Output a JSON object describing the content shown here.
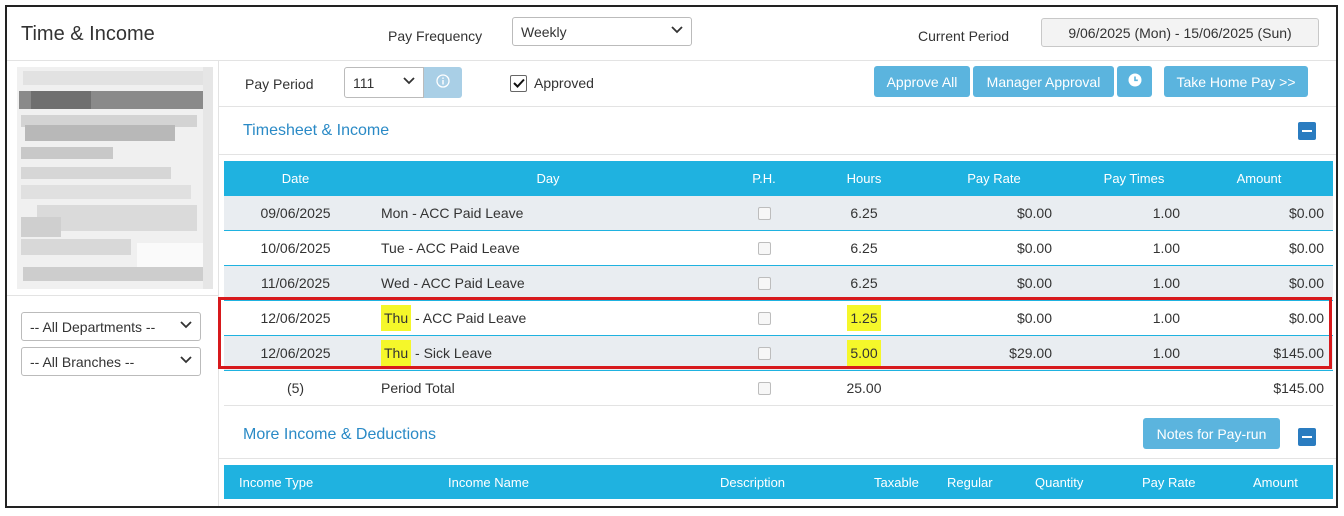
{
  "header": {
    "title": "Time & Income",
    "pay_frequency_label": "Pay Frequency",
    "pay_frequency_value": "Weekly",
    "current_period_label": "Current Period",
    "current_period_value": "9/06/2025 (Mon) - 15/06/2025 (Sun)"
  },
  "filters": {
    "departments": "-- All Departments --",
    "branches": "-- All Branches --"
  },
  "toolbar": {
    "pay_period_label": "Pay Period",
    "pay_period_value": "111",
    "approved_label": "Approved",
    "approved_checked": true,
    "approve_all": "Approve All",
    "manager_approval": "Manager Approval",
    "take_home_pay": "Take Home Pay >>"
  },
  "timesheet": {
    "title": "Timesheet & Income",
    "columns": [
      "Date",
      "Day",
      "P.H.",
      "Hours",
      "Pay Rate",
      "Pay Times",
      "Amount"
    ],
    "rows": [
      {
        "date": "09/06/2025",
        "day_prefix": "Mon",
        "day_rest": " - ACC Paid Leave",
        "hours": "6.25",
        "rate": "$0.00",
        "times": "1.00",
        "amount": "$0.00"
      },
      {
        "date": "10/06/2025",
        "day_prefix": "Tue",
        "day_rest": " - ACC Paid Leave",
        "hours": "6.25",
        "rate": "$0.00",
        "times": "1.00",
        "amount": "$0.00"
      },
      {
        "date": "11/06/2025",
        "day_prefix": "Wed",
        "day_rest": " - ACC Paid Leave",
        "hours": "6.25",
        "rate": "$0.00",
        "times": "1.00",
        "amount": "$0.00"
      },
      {
        "date": "12/06/2025",
        "day_prefix": "Thu",
        "day_rest": " - ACC Paid Leave",
        "hours": "1.25",
        "rate": "$0.00",
        "times": "1.00",
        "amount": "$0.00"
      },
      {
        "date": "12/06/2025",
        "day_prefix": "Thu",
        "day_rest": " - Sick Leave",
        "hours": "5.00",
        "rate": "$29.00",
        "times": "1.00",
        "amount": "$145.00"
      }
    ],
    "total": {
      "count": "(5)",
      "label": "Period Total",
      "hours": "25.00",
      "amount": "$145.00"
    }
  },
  "more_income": {
    "title": "More Income & Deductions",
    "notes_button": "Notes for Pay-run",
    "columns": [
      "Income Type",
      "Income Name",
      "Description",
      "Taxable",
      "Regular",
      "Quantity",
      "Pay Rate",
      "Amount"
    ]
  },
  "colors": {
    "accent": "#1fb2e0",
    "button": "#5bb4de",
    "highlight": "#f5f72a",
    "annotation": "#d7191c",
    "section_title": "#2a8ac6"
  }
}
